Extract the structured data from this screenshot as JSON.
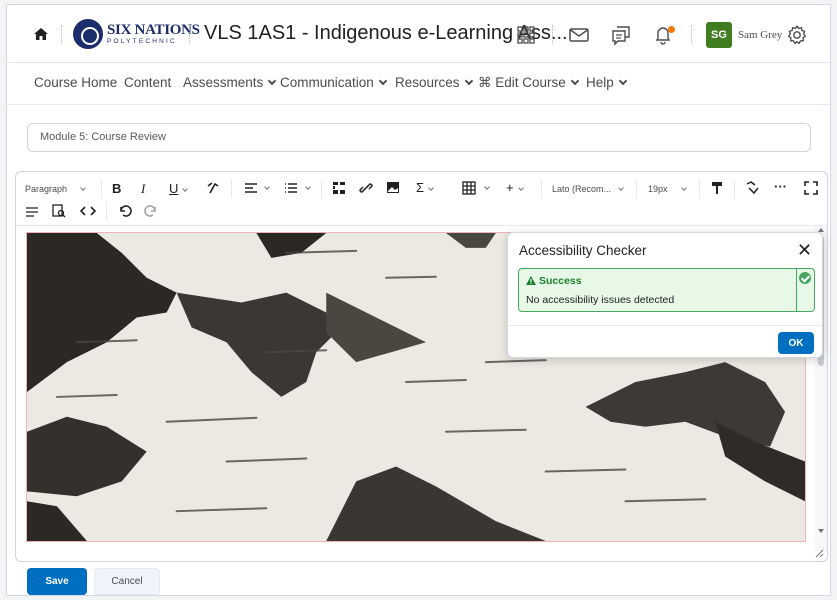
{
  "header": {
    "home_icon": "home-icon",
    "logo_main": "SIX NATIONS",
    "logo_sub": "POLYTECHNIC",
    "course_title": "VLS 1AS1 - Indigenous e-Learning Ass...",
    "icons": [
      "grid-icon",
      "mail-icon",
      "chat-icon",
      "bell-icon",
      "gear-icon"
    ],
    "avatar_initials": "SG",
    "avatar_color": "#3f7d20",
    "username": "Sam Grey"
  },
  "nav": {
    "items": [
      {
        "label": "Course Home",
        "dropdown": false
      },
      {
        "label": "Content",
        "dropdown": false
      },
      {
        "label": "Assessments",
        "dropdown": true
      },
      {
        "label": "Communication",
        "dropdown": true
      },
      {
        "label": "Resources",
        "dropdown": true
      },
      {
        "label": "⌘ Edit Course",
        "dropdown": true
      },
      {
        "label": "Help",
        "dropdown": true
      }
    ]
  },
  "title_field": {
    "value": "Module 5: Course Review"
  },
  "toolbar": {
    "format": "Paragraph",
    "font": "Lato (Recom...",
    "size": "19px",
    "bold": "B",
    "italic": "I",
    "underline": "U",
    "sigma": "Σ",
    "insert": "+",
    "more": "···"
  },
  "dialog": {
    "title": "Accessibility Checker",
    "close": "✕",
    "alert_title": "Success",
    "alert_text": "No accessibility issues detected",
    "ok_label": "OK",
    "accent": "#006fbf",
    "success_color": "#46a661"
  },
  "footer": {
    "save_label": "Save",
    "cancel_label": "Cancel"
  }
}
